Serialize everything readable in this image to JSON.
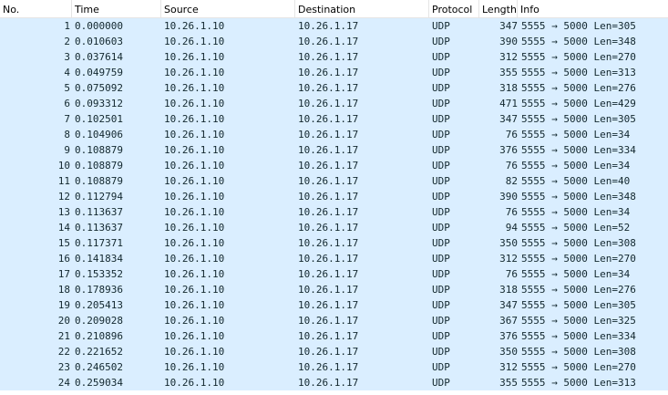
{
  "columns": {
    "no": "No.",
    "time": "Time",
    "source": "Source",
    "destination": "Destination",
    "protocol": "Protocol",
    "length": "Length",
    "info": "Info"
  },
  "colors": {
    "row_background": "#daeeff",
    "row_text": "#12272e",
    "header_background": "#ffffff"
  },
  "packets": [
    {
      "no": "1",
      "time": "0.000000",
      "source": "10.26.1.10",
      "destination": "10.26.1.17",
      "protocol": "UDP",
      "length": "347",
      "info": "5555 → 5000 Len=305"
    },
    {
      "no": "2",
      "time": "0.010603",
      "source": "10.26.1.10",
      "destination": "10.26.1.17",
      "protocol": "UDP",
      "length": "390",
      "info": "5555 → 5000 Len=348"
    },
    {
      "no": "3",
      "time": "0.037614",
      "source": "10.26.1.10",
      "destination": "10.26.1.17",
      "protocol": "UDP",
      "length": "312",
      "info": "5555 → 5000 Len=270"
    },
    {
      "no": "4",
      "time": "0.049759",
      "source": "10.26.1.10",
      "destination": "10.26.1.17",
      "protocol": "UDP",
      "length": "355",
      "info": "5555 → 5000 Len=313"
    },
    {
      "no": "5",
      "time": "0.075092",
      "source": "10.26.1.10",
      "destination": "10.26.1.17",
      "protocol": "UDP",
      "length": "318",
      "info": "5555 → 5000 Len=276"
    },
    {
      "no": "6",
      "time": "0.093312",
      "source": "10.26.1.10",
      "destination": "10.26.1.17",
      "protocol": "UDP",
      "length": "471",
      "info": "5555 → 5000 Len=429"
    },
    {
      "no": "7",
      "time": "0.102501",
      "source": "10.26.1.10",
      "destination": "10.26.1.17",
      "protocol": "UDP",
      "length": "347",
      "info": "5555 → 5000 Len=305"
    },
    {
      "no": "8",
      "time": "0.104906",
      "source": "10.26.1.10",
      "destination": "10.26.1.17",
      "protocol": "UDP",
      "length": "76",
      "info": "5555 → 5000 Len=34"
    },
    {
      "no": "9",
      "time": "0.108879",
      "source": "10.26.1.10",
      "destination": "10.26.1.17",
      "protocol": "UDP",
      "length": "376",
      "info": "5555 → 5000 Len=334"
    },
    {
      "no": "10",
      "time": "0.108879",
      "source": "10.26.1.10",
      "destination": "10.26.1.17",
      "protocol": "UDP",
      "length": "76",
      "info": "5555 → 5000 Len=34"
    },
    {
      "no": "11",
      "time": "0.108879",
      "source": "10.26.1.10",
      "destination": "10.26.1.17",
      "protocol": "UDP",
      "length": "82",
      "info": "5555 → 5000 Len=40"
    },
    {
      "no": "12",
      "time": "0.112794",
      "source": "10.26.1.10",
      "destination": "10.26.1.17",
      "protocol": "UDP",
      "length": "390",
      "info": "5555 → 5000 Len=348"
    },
    {
      "no": "13",
      "time": "0.113637",
      "source": "10.26.1.10",
      "destination": "10.26.1.17",
      "protocol": "UDP",
      "length": "76",
      "info": "5555 → 5000 Len=34"
    },
    {
      "no": "14",
      "time": "0.113637",
      "source": "10.26.1.10",
      "destination": "10.26.1.17",
      "protocol": "UDP",
      "length": "94",
      "info": "5555 → 5000 Len=52"
    },
    {
      "no": "15",
      "time": "0.117371",
      "source": "10.26.1.10",
      "destination": "10.26.1.17",
      "protocol": "UDP",
      "length": "350",
      "info": "5555 → 5000 Len=308"
    },
    {
      "no": "16",
      "time": "0.141834",
      "source": "10.26.1.10",
      "destination": "10.26.1.17",
      "protocol": "UDP",
      "length": "312",
      "info": "5555 → 5000 Len=270"
    },
    {
      "no": "17",
      "time": "0.153352",
      "source": "10.26.1.10",
      "destination": "10.26.1.17",
      "protocol": "UDP",
      "length": "76",
      "info": "5555 → 5000 Len=34"
    },
    {
      "no": "18",
      "time": "0.178936",
      "source": "10.26.1.10",
      "destination": "10.26.1.17",
      "protocol": "UDP",
      "length": "318",
      "info": "5555 → 5000 Len=276"
    },
    {
      "no": "19",
      "time": "0.205413",
      "source": "10.26.1.10",
      "destination": "10.26.1.17",
      "protocol": "UDP",
      "length": "347",
      "info": "5555 → 5000 Len=305"
    },
    {
      "no": "20",
      "time": "0.209028",
      "source": "10.26.1.10",
      "destination": "10.26.1.17",
      "protocol": "UDP",
      "length": "367",
      "info": "5555 → 5000 Len=325"
    },
    {
      "no": "21",
      "time": "0.210896",
      "source": "10.26.1.10",
      "destination": "10.26.1.17",
      "protocol": "UDP",
      "length": "376",
      "info": "5555 → 5000 Len=334"
    },
    {
      "no": "22",
      "time": "0.221652",
      "source": "10.26.1.10",
      "destination": "10.26.1.17",
      "protocol": "UDP",
      "length": "350",
      "info": "5555 → 5000 Len=308"
    },
    {
      "no": "23",
      "time": "0.246502",
      "source": "10.26.1.10",
      "destination": "10.26.1.17",
      "protocol": "UDP",
      "length": "312",
      "info": "5555 → 5000 Len=270"
    },
    {
      "no": "24",
      "time": "0.259034",
      "source": "10.26.1.10",
      "destination": "10.26.1.17",
      "protocol": "UDP",
      "length": "355",
      "info": "5555 → 5000 Len=313"
    }
  ]
}
